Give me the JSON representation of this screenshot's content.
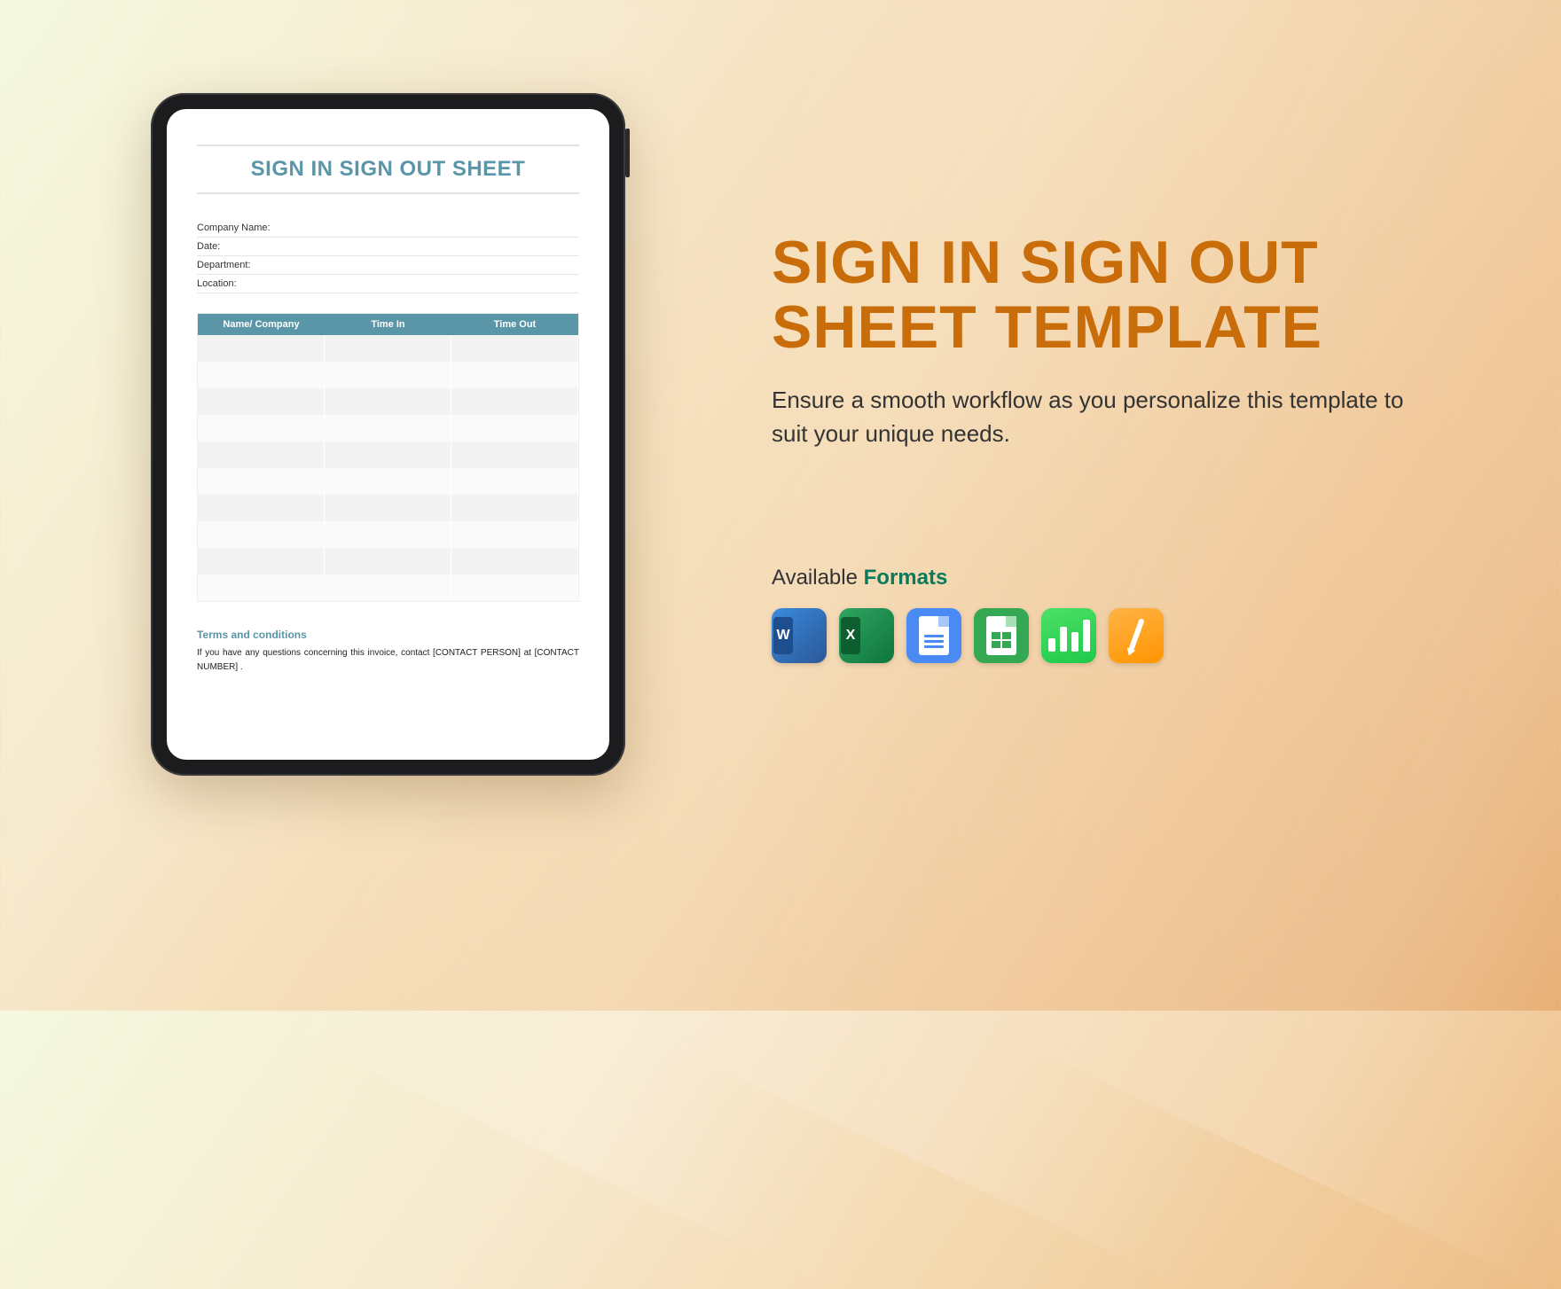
{
  "document": {
    "title": "SIGN IN SIGN OUT SHEET",
    "meta_labels": {
      "company": "Company Name:",
      "date": "Date:",
      "department": "Department:",
      "location": "Location:"
    },
    "columns": {
      "name": "Name/ Company",
      "time_in": "Time In",
      "time_out": "Time Out"
    },
    "terms_heading": "Terms and conditions",
    "terms_body": "If you have any questions concerning this invoice, contact [CONTACT PERSON] at [CONTACT NUMBER] ."
  },
  "promo": {
    "title": "SIGN IN SIGN OUT SHEET TEMPLATE",
    "description": "Ensure a smooth workflow as you personalize this template to suit your unique needs.",
    "formats_label_pre": "Available ",
    "formats_label_em": "Formats",
    "formats": [
      {
        "name": "Microsoft Word",
        "slug": "word",
        "letter": "W"
      },
      {
        "name": "Microsoft Excel",
        "slug": "excel",
        "letter": "X"
      },
      {
        "name": "Google Docs",
        "slug": "gdocs"
      },
      {
        "name": "Google Sheets",
        "slug": "gsheets"
      },
      {
        "name": "Apple Numbers",
        "slug": "numbers"
      },
      {
        "name": "Apple Pages",
        "slug": "pages"
      }
    ]
  }
}
